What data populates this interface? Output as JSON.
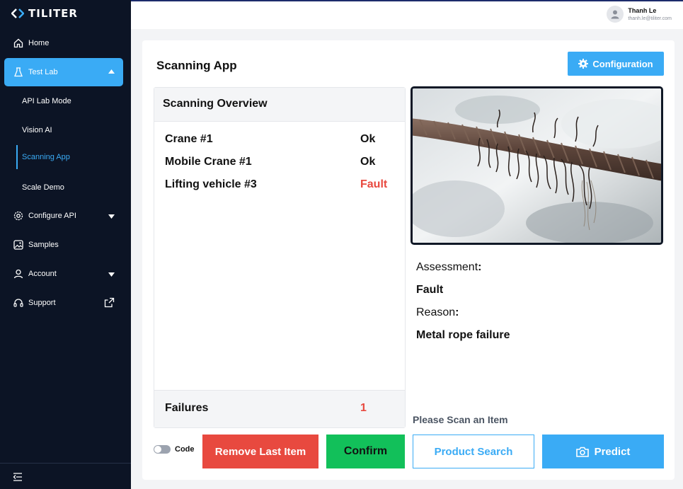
{
  "app": {
    "logo_text": "TILITER"
  },
  "sidebar": {
    "items": [
      {
        "label": "Home",
        "icon": "home-icon"
      },
      {
        "label": "Test Lab",
        "icon": "beaker-icon",
        "active": true
      },
      {
        "label": "Configure API",
        "icon": "gear-icon"
      },
      {
        "label": "Samples",
        "icon": "image-icon"
      },
      {
        "label": "Account",
        "icon": "user-icon"
      },
      {
        "label": "Support",
        "icon": "headset-icon"
      }
    ],
    "subitems": [
      {
        "label": "API Lab Mode"
      },
      {
        "label": "Vision AI"
      },
      {
        "label": "Scanning App",
        "selected": true
      },
      {
        "label": "Scale Demo"
      }
    ]
  },
  "user": {
    "name": "Thanh Le",
    "email": "thanh.le@tiliter.com"
  },
  "main": {
    "title": "Scanning App",
    "config_button": "Configuration",
    "overview": {
      "title": "Scanning Overview",
      "rows": [
        {
          "name": "Crane #1",
          "status": "Ok"
        },
        {
          "name": "Mobile Crane #1",
          "status": "Ok"
        },
        {
          "name": "Lifting vehicle #3",
          "status": "Fault"
        }
      ],
      "failures_label": "Failures",
      "failures_count": "1"
    },
    "assessment": {
      "label": "Assessment",
      "value": "Fault",
      "reason_label": "Reason",
      "reason_value": "Metal rope failure"
    },
    "scan_prompt": "Please Scan an Item",
    "code_label": "Code",
    "buttons": {
      "remove": "Remove Last Item",
      "confirm": "Confirm",
      "search": "Product Search",
      "predict": "Predict"
    }
  },
  "colors": {
    "accent": "#3aabf5",
    "danger": "#e8493f",
    "success": "#12c05a",
    "sidebar": "#0c1425"
  }
}
